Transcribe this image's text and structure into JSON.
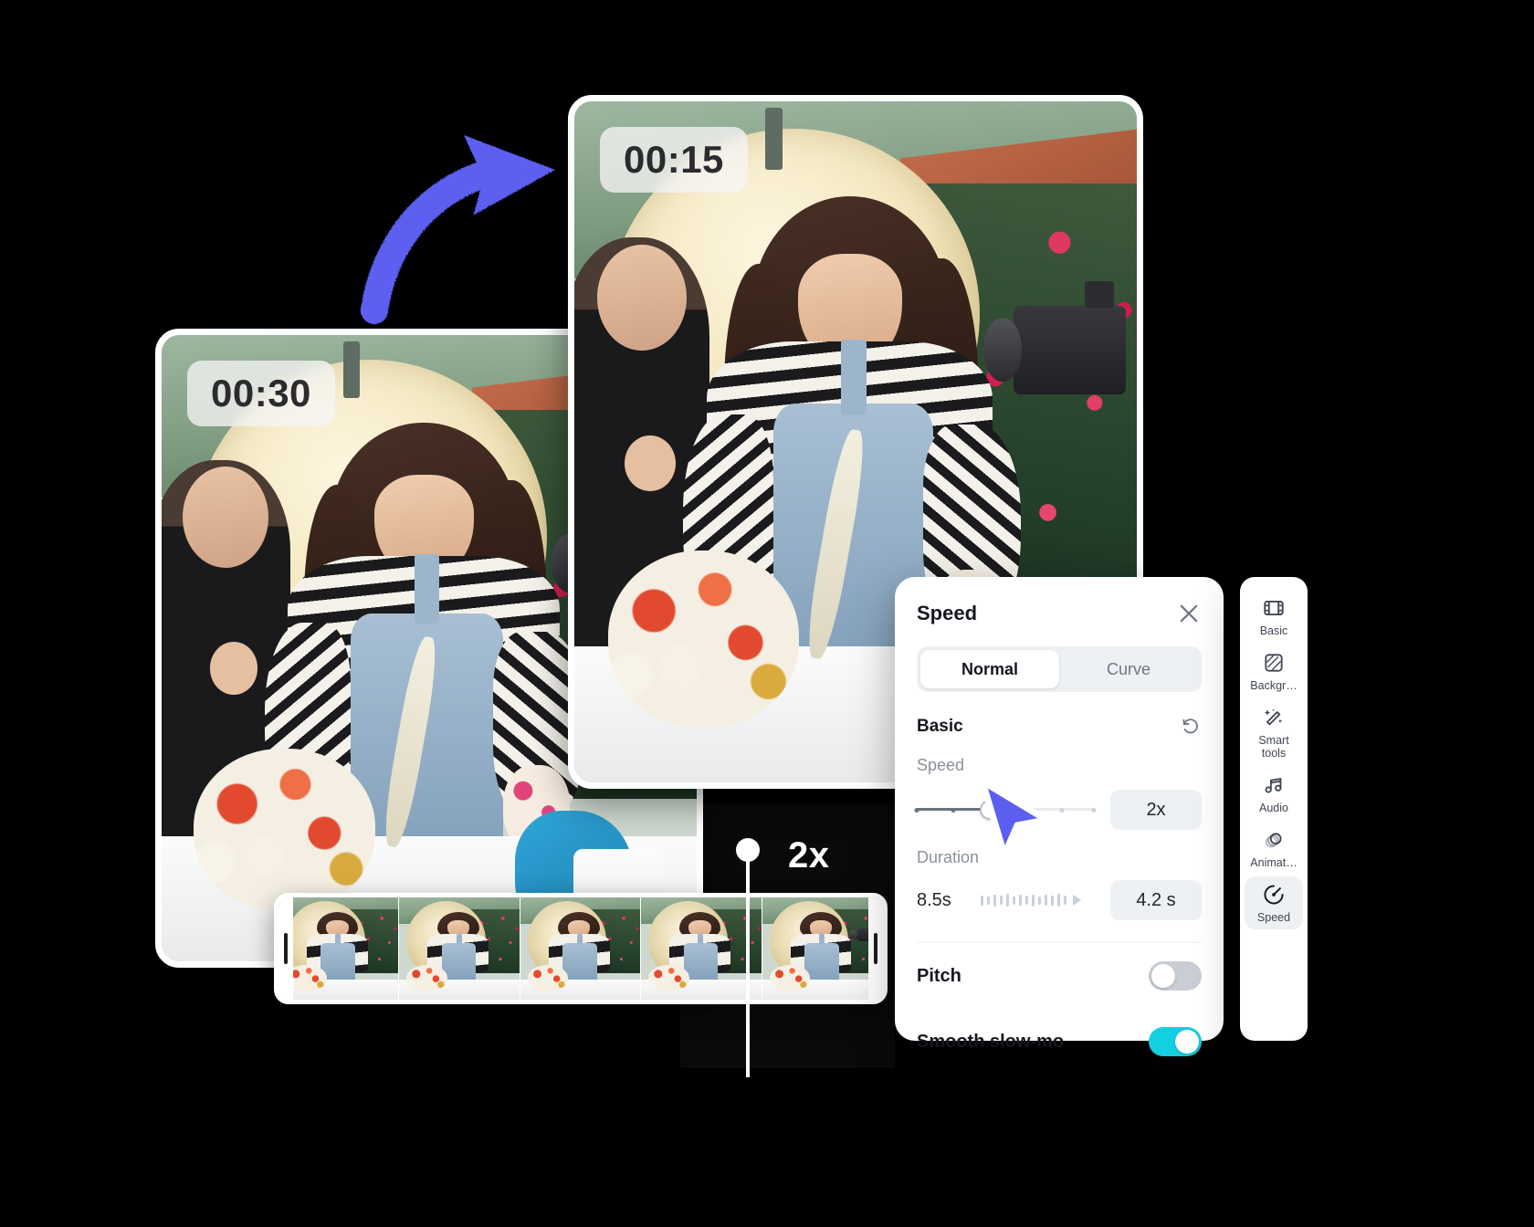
{
  "cards": {
    "front": {
      "timestamp": "00:15"
    },
    "back": {
      "timestamp": "00:30"
    }
  },
  "timeline": {
    "speed_label": "2x"
  },
  "speed_panel": {
    "title": "Speed",
    "close_icon": "close-icon",
    "tabs": [
      {
        "label": "Normal",
        "active": true
      },
      {
        "label": "Curve",
        "active": false
      }
    ],
    "section": {
      "title": "Basic",
      "reset_icon": "reset-icon"
    },
    "speed": {
      "label": "Speed",
      "value": "2x"
    },
    "duration": {
      "label": "Duration",
      "from": "8.5s",
      "to": "4.2 s"
    },
    "toggles": [
      {
        "label": "Pitch",
        "on": false
      },
      {
        "label": "Smooth slow-mo",
        "on": true
      }
    ]
  },
  "sidebar": {
    "items": [
      {
        "label": "Basic",
        "icon": "filmstrip-icon",
        "active": false
      },
      {
        "label": "Backgr…",
        "icon": "background-icon",
        "active": false
      },
      {
        "label": "Smart\ntools",
        "icon": "magic-wand-icon",
        "active": false
      },
      {
        "label": "Audio",
        "icon": "music-note-icon",
        "active": false
      },
      {
        "label": "Animat…",
        "icon": "animation-icon",
        "active": false
      },
      {
        "label": "Speed",
        "icon": "speedometer-icon",
        "active": true
      }
    ]
  },
  "colors": {
    "accent_blue": "#5B5FEF",
    "toggle_on": "#14CFE0",
    "panel_bg": "#FFFFFF",
    "chip_bg": "#EEF1F4",
    "text_dark": "#15181F",
    "text_muted": "#8A9199"
  }
}
